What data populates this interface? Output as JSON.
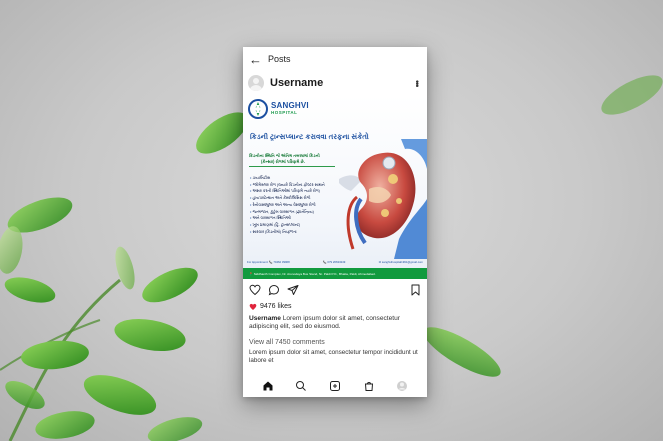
{
  "colors": {
    "brand_blue": "#1c4fa0",
    "brand_green": "#119a3e",
    "heart_red": "#e0243c",
    "leaf_green": "#3ea12c"
  },
  "header": {
    "back_icon": "arrow-left-icon",
    "title": "Posts"
  },
  "user": {
    "name": "Username",
    "more_icon": "more-vertical-icon"
  },
  "post": {
    "logo": {
      "name": "SANGHVI",
      "sub": "HOSPITAL"
    },
    "headline": "કિડની ટ્રાન્સપ્લાન્ટ કરાવવા તરફના સંકેતો",
    "subtitle_line1": "કિડનીના સ્થિતિ જે અંતિમ તબક્કામાં કિડની",
    "subtitle_line2": "(કેન્સર) રોગમાં પરિણમે છે.",
    "bullets": [
      "ડાયાબિટીસ",
      "ગ્લોમેરુલર રોગ (જ્યારે કિડનીના ફોલ્ટર સાથને",
      "અસર કરતી સ્થિતિઓમાં પરિણમે ત્યારે રોગ)",
      "હાયપરટેન્શન અને કેસ્કોલિસિસ રોગો",
      "રેનોવાસ્ક્યુલર અને અન્ય વેસ્ક્યુલર રોગો",
      "જન્મજાત, કુટુંબ વારસાગત (જ્ઞાનેન્દ્રિય)",
      "અને વારસાગત સ્થિતિઓ",
      "ખૂબ પ્રમાણમાં (ટ્રિ. ટ્રાન્સપ્લાન્ટ)",
      "સારવાર (કિડનીમાં) નિષ્ફળતા"
    ],
    "contact": {
      "appointment": "For Appointment: 📞 70462 39968",
      "phone": "📞 079 26633249",
      "email": "✉ sanghvihospital1991@gmail.com"
    },
    "address": "📍 Siddhanth Complex, Nr. Arunodaya Bus Stand, Nr. Paldi P.O., Bhatta, Paldi, Ahmedabad."
  },
  "actions": {
    "like_icon": "heart-icon",
    "comment_icon": "comment-icon",
    "share_icon": "send-icon",
    "save_icon": "bookmark-icon"
  },
  "likes": {
    "count": "9476 likes",
    "icon": "heart-filled-icon"
  },
  "caption": {
    "username": "Username",
    "text": " Lorem ipsum dolor sit amet, consectetur adipiscing elit, sed do eiusmod."
  },
  "comments": {
    "view_all": "View all 7450 comments",
    "preview": "Lorem ipsum dolor sit amet, consectetur tempor incididunt ut labore et"
  },
  "nav": [
    "home-icon",
    "search-icon",
    "add-post-icon",
    "shop-icon",
    "profile-icon"
  ]
}
